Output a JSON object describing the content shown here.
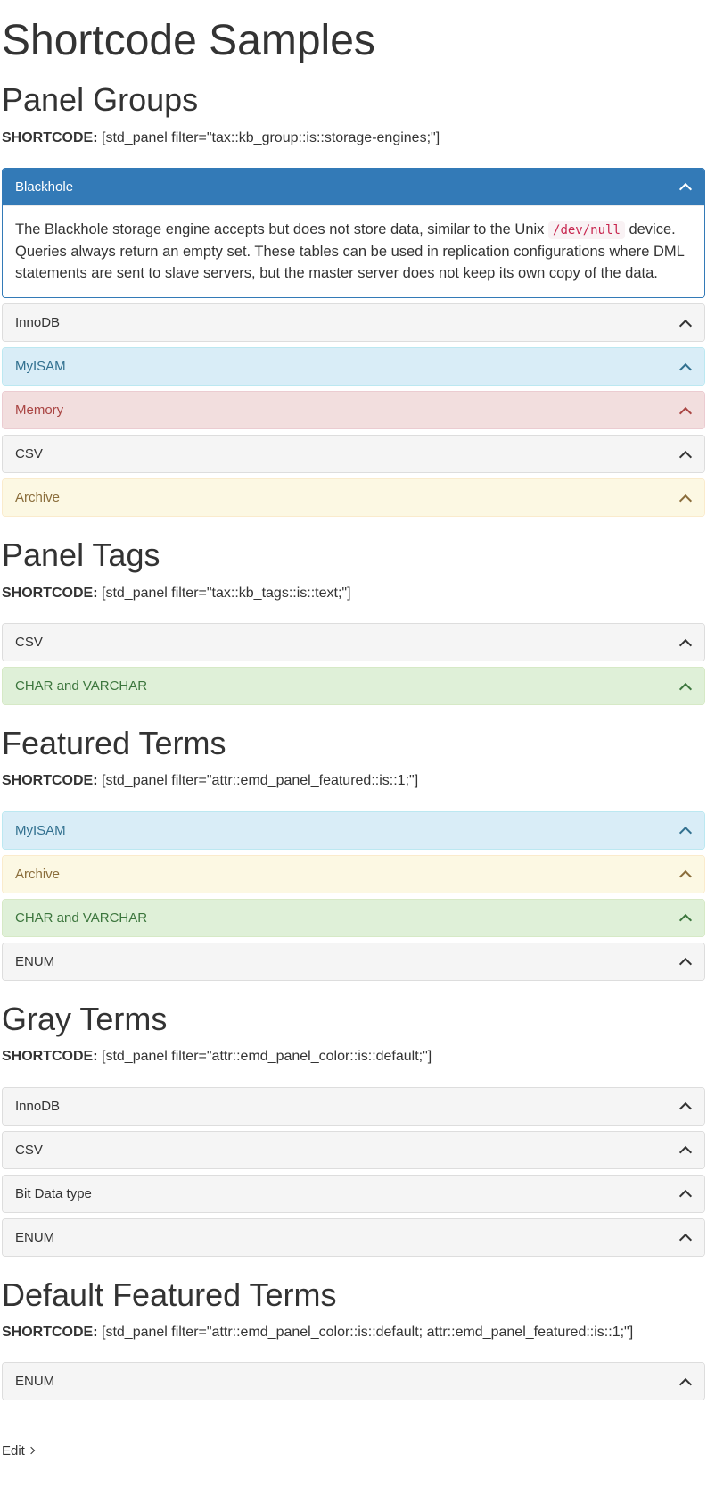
{
  "page_title": "Shortcode Samples",
  "shortcode_label": "SHORTCODE:",
  "sections": [
    {
      "title": "Panel Groups",
      "shortcode": "[std_panel filter=\"tax::kb_group::is::storage-engines;\"]",
      "panels": [
        {
          "title": "Blackhole",
          "variant": "primary",
          "expanded": true,
          "body_parts": [
            "The Blackhole storage engine accepts but does not store data, similar to the Unix ",
            {
              "code": "/dev/null"
            },
            " device. Queries always return an empty set. These tables can be used in replication configurations where DML statements are sent to slave servers, but the master server does not keep its own copy of the data."
          ]
        },
        {
          "title": "InnoDB",
          "variant": "default",
          "expanded": false
        },
        {
          "title": "MyISAM",
          "variant": "info",
          "expanded": false
        },
        {
          "title": "Memory",
          "variant": "danger",
          "expanded": false
        },
        {
          "title": "CSV",
          "variant": "default",
          "expanded": false
        },
        {
          "title": "Archive",
          "variant": "warning",
          "expanded": false
        }
      ]
    },
    {
      "title": "Panel Tags",
      "shortcode": "[std_panel filter=\"tax::kb_tags::is::text;\"]",
      "panels": [
        {
          "title": "CSV",
          "variant": "default",
          "expanded": false
        },
        {
          "title": "CHAR and VARCHAR",
          "variant": "success",
          "expanded": false
        }
      ]
    },
    {
      "title": "Featured Terms",
      "shortcode": "[std_panel filter=\"attr::emd_panel_featured::is::1;\"]",
      "panels": [
        {
          "title": "MyISAM",
          "variant": "info",
          "expanded": false
        },
        {
          "title": "Archive",
          "variant": "warning",
          "expanded": false
        },
        {
          "title": "CHAR and VARCHAR",
          "variant": "success",
          "expanded": false
        },
        {
          "title": "ENUM",
          "variant": "default",
          "expanded": false
        }
      ]
    },
    {
      "title": "Gray Terms",
      "shortcode": "[std_panel filter=\"attr::emd_panel_color::is::default;\"]",
      "panels": [
        {
          "title": "InnoDB",
          "variant": "default",
          "expanded": false
        },
        {
          "title": "CSV",
          "variant": "default",
          "expanded": false
        },
        {
          "title": "Bit Data type",
          "variant": "default",
          "expanded": false
        },
        {
          "title": "ENUM",
          "variant": "default",
          "expanded": false
        }
      ]
    },
    {
      "title": "Default Featured Terms",
      "shortcode": "[std_panel filter=\"attr::emd_panel_color::is::default; attr::emd_panel_featured::is::1;\"]",
      "panels": [
        {
          "title": "ENUM",
          "variant": "default",
          "expanded": false
        }
      ]
    }
  ],
  "edit_link": "Edit"
}
